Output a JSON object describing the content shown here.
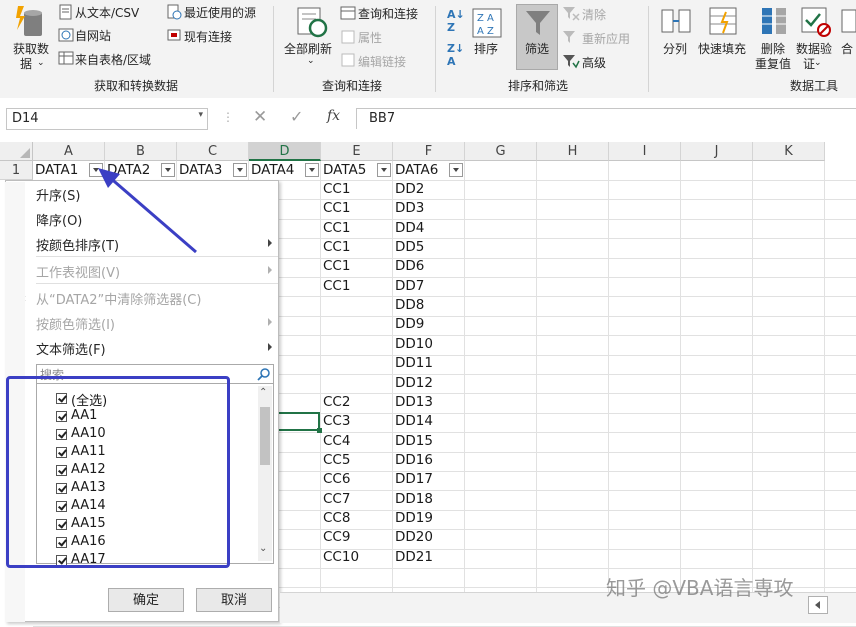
{
  "ribbon": {
    "get_data": "获取数",
    "get_data2": "据",
    "from_text_csv": "从文本/CSV",
    "from_web": "自网站",
    "from_table": "来自表格/区域",
    "recent_sources": "最近使用的源",
    "existing_conn": "现有连接",
    "group_get_transform": "获取和转换数据",
    "refresh_all": "全部刷新",
    "queries_conn": "查询和连接",
    "properties": "属性",
    "edit_links": "编辑链接",
    "group_queries": "查询和连接",
    "sort": "排序",
    "filter": "筛选",
    "clear": "清除",
    "reapply": "重新应用",
    "advanced": "高级",
    "group_sort_filter": "排序和筛选",
    "split": "分列",
    "flash_fill": "快速填充",
    "remove_dup1": "删除",
    "remove_dup2": "重复值",
    "validation1": "数据验",
    "validation2": "证",
    "consolidate": "合",
    "group_data_tools": "数据工具"
  },
  "formula_bar": {
    "name_box": "D14",
    "fx": "fx",
    "value": "BB7"
  },
  "columns": [
    "A",
    "B",
    "C",
    "D",
    "E",
    "F",
    "G",
    "H",
    "I",
    "J",
    "K"
  ],
  "selected_column": "D",
  "header_row": {
    "row_num": "1",
    "cells": [
      "DATA1",
      "DATA2",
      "DATA3",
      "DATA4",
      "DATA5",
      "DATA6"
    ]
  },
  "col_e": [
    "CC1",
    "CC1",
    "CC1",
    "CC1",
    "CC1",
    "CC1",
    "",
    "",
    "",
    "",
    "",
    "CC2",
    "CC3",
    "CC4",
    "CC5",
    "CC6",
    "CC7",
    "CC8",
    "CC9",
    "CC10"
  ],
  "col_f": [
    "DD2",
    "DD3",
    "DD4",
    "DD5",
    "DD6",
    "DD7",
    "DD8",
    "DD9",
    "DD10",
    "DD11",
    "DD12",
    "DD13",
    "DD14",
    "DD15",
    "DD16",
    "DD17",
    "DD18",
    "DD19",
    "DD20",
    "DD21"
  ],
  "filter_menu": {
    "sort_asc": "升序(S)",
    "sort_desc": "降序(O)",
    "sort_color": "按颜色排序(T)",
    "sheet_view": "工作表视图(V)",
    "clear_filter": "从“DATA2”中清除筛选器(C)",
    "filter_color": "按颜色筛选(I)",
    "text_filter": "文本筛选(F)",
    "search_placeholder": "搜索",
    "items": [
      "(全选)",
      "AA1",
      "AA10",
      "AA11",
      "AA12",
      "AA13",
      "AA14",
      "AA15",
      "AA16",
      "AA17"
    ],
    "ok": "确定",
    "cancel": "取消"
  },
  "watermark": "知乎 @VBA语言専攻",
  "colors": {
    "excel_green": "#217346",
    "highlight_box": "#3b3fc4",
    "arrow": "#3b3fc4"
  }
}
